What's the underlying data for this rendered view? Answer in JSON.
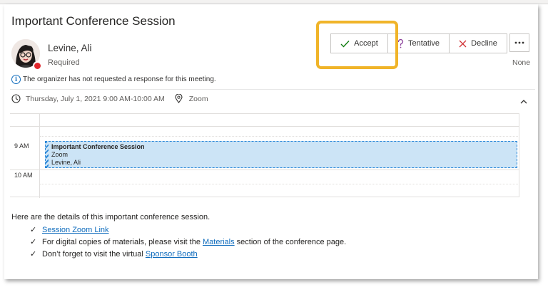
{
  "meeting": {
    "title": "Important Conference Session",
    "organizer_name": "Levine, Ali",
    "organizer_role": "Required",
    "info_text": "The organizer has not requested a response for this meeting.",
    "datetime": "Thursday, July 1, 2021 9:00 AM-10:00 AM",
    "location": "Zoom"
  },
  "actions": {
    "accept": "Accept",
    "tentative": "Tentative",
    "decline": "Decline",
    "response_status": "None"
  },
  "calendar": {
    "hour_labels": [
      "9 AM",
      "10 AM"
    ],
    "event": {
      "title": "Important Conference Session",
      "location": "Zoom",
      "organizer": "Levine, Ali"
    }
  },
  "body": {
    "intro": "Here are the details of this important conference session.",
    "item1_link": "Session Zoom Link",
    "item2_prefix": "For digital copies of materials, please visit the ",
    "item2_link": "Materials",
    "item2_suffix": " section of the conference page.",
    "item3_prefix": "Don’t forget to visit the virtual ",
    "item3_link": "Sponsor Booth"
  },
  "colors": {
    "accent": "#0f6cbd",
    "highlight": "#f0b429",
    "event_fill": "#cce4f6",
    "decline_x": "#d13438",
    "accept_check": "#107c10",
    "presence_busy": "#e0262c"
  },
  "icons": {
    "accept": "checkmark-icon",
    "tentative": "question-icon",
    "decline": "x-icon",
    "more": "ellipsis-icon",
    "clock": "clock-icon",
    "location": "location-pin-icon",
    "info": "info-icon",
    "collapse": "chevron-up-icon"
  }
}
